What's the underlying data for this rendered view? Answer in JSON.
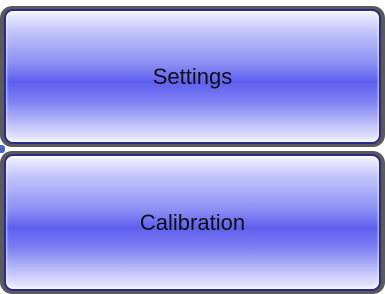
{
  "menu": {
    "buttons": [
      {
        "label": "Settings"
      },
      {
        "label": "Calibration"
      }
    ]
  },
  "colors": {
    "frame": "#5a5a5a",
    "button_border": "#2a2a8a",
    "button_gradient_top": "#f4f4ff",
    "button_gradient_mid": "#5e5fef",
    "text": "#111111"
  }
}
